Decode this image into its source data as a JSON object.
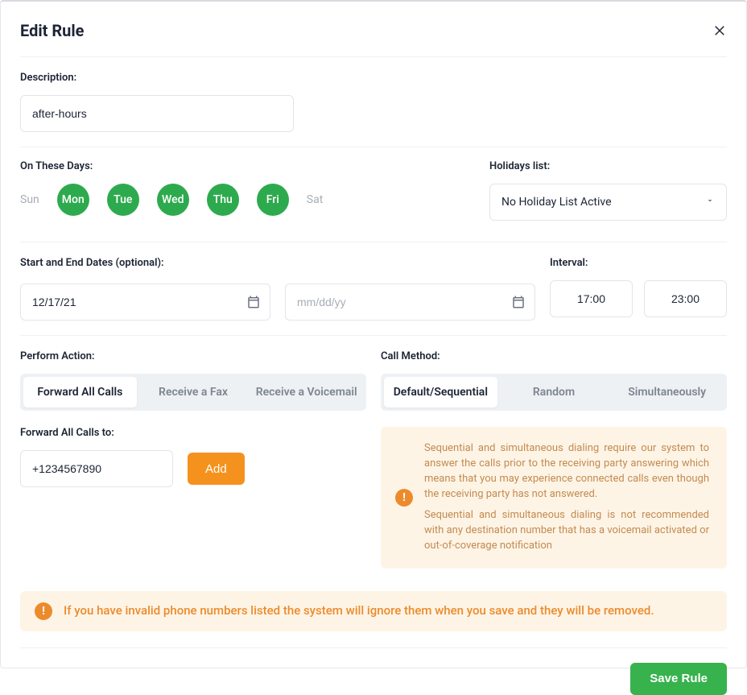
{
  "header": {
    "title": "Edit Rule"
  },
  "description": {
    "label": "Description:",
    "value": "after-hours"
  },
  "daysSection": {
    "label": "On These Days:",
    "days": [
      {
        "abbr": "Sun",
        "active": false
      },
      {
        "abbr": "Mon",
        "active": true
      },
      {
        "abbr": "Tue",
        "active": true
      },
      {
        "abbr": "Wed",
        "active": true
      },
      {
        "abbr": "Thu",
        "active": true
      },
      {
        "abbr": "Fri",
        "active": true
      },
      {
        "abbr": "Sat",
        "active": false
      }
    ]
  },
  "holidays": {
    "label": "Holidays list:",
    "selected": "No Holiday List Active"
  },
  "dates": {
    "label": "Start and End Dates (optional):",
    "start": "12/17/21",
    "end_placeholder": "mm/dd/yy"
  },
  "interval": {
    "label": "Interval:",
    "from": "17:00",
    "to": "23:00"
  },
  "performAction": {
    "label": "Perform Action:",
    "options": [
      {
        "label": "Forward All Calls",
        "active": true
      },
      {
        "label": "Receive a Fax",
        "active": false
      },
      {
        "label": "Receive a Voicemail",
        "active": false
      }
    ]
  },
  "callMethod": {
    "label": "Call Method:",
    "options": [
      {
        "label": "Default/Sequential",
        "active": true
      },
      {
        "label": "Random",
        "active": false
      },
      {
        "label": "Simultaneously",
        "active": false
      }
    ]
  },
  "forward": {
    "label": "Forward All Calls to:",
    "phone": "+1234567890",
    "add_button": "Add"
  },
  "methodInfo": {
    "p1": "Sequential and simultaneous dialing require our system to answer the calls prior to the receiving party answering which means that you may experience connected calls even though the receiving party has not answered.",
    "p2": "Sequential and simultaneous dialing is not recommended with any destination number that has a voicemail activated or out-of-coverage notification"
  },
  "bottomWarning": "If you have invalid phone numbers listed the system will ignore them when you save and they will be removed.",
  "footer": {
    "save": "Save Rule"
  }
}
